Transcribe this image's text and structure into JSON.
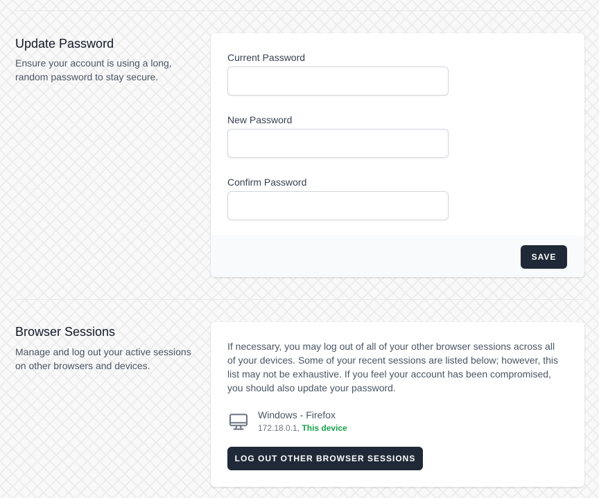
{
  "update_password": {
    "title": "Update Password",
    "description": "Ensure your account is using a long, random password to stay secure.",
    "fields": [
      {
        "label": "Current Password",
        "value": "",
        "placeholder": ""
      },
      {
        "label": "New Password",
        "value": "",
        "placeholder": ""
      },
      {
        "label": "Confirm Password",
        "value": "",
        "placeholder": ""
      }
    ],
    "save_label": "Save"
  },
  "browser_sessions": {
    "title": "Browser Sessions",
    "description": "Manage and log out your active sessions on other browsers and devices.",
    "info": "If necessary, you may log out of all of your other browser sessions across all of your devices. Some of your recent sessions are listed below; however, this list may not be exhaustive. If you feel your account has been compromised, you should also update your password.",
    "sessions": [
      {
        "device": "Windows - Firefox",
        "ip": "172.18.0.1,",
        "status": "This device",
        "icon": "desktop-monitor-icon"
      }
    ],
    "logout_label": "Log Out Other Browser Sessions"
  },
  "colors": {
    "primary_button": "#1f2937",
    "this_device": "#16a34a",
    "background": "#f9f9f9"
  }
}
